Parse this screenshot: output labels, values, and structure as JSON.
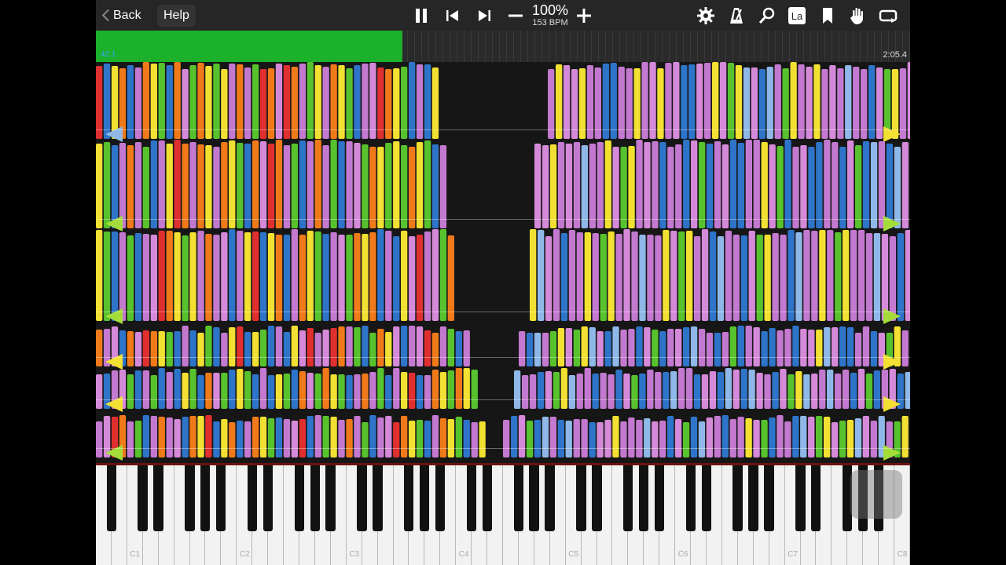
{
  "toolbar": {
    "back_label": "Back",
    "help_label": "Help",
    "tempo_percent": "100%",
    "tempo_bpm": "153 BPM",
    "icons": [
      "pause-icon",
      "skip-back-icon",
      "skip-forward-icon",
      "minus-icon",
      "plus-icon",
      "gear-icon",
      "metronome-icon",
      "search-icon",
      "label-icon",
      "bookmark-icon",
      "hand-icon",
      "loop-icon"
    ],
    "label_icon_text": "La"
  },
  "progress": {
    "fraction": 0.376,
    "current_time": "42.1",
    "total_time": "2:05.4",
    "fill_color": "#1bb12a"
  },
  "note_roll": {
    "colors": {
      "red": "#e02f2f",
      "orange": "#f07a1a",
      "yellow": "#f2e032",
      "green": "#57c22d",
      "blue": "#2e74c9",
      "lightblue": "#8fb8e8",
      "purple": "#c379cf",
      "pink": "#d58ad9"
    },
    "hand_markers": [
      "#8fb8e8",
      "#a4dd3a",
      "#a4dd3a",
      "#f2e032",
      "#f2e032",
      "#a4dd3a"
    ]
  },
  "keyboard": {
    "octave_labels": [
      "C1",
      "C2",
      "C3",
      "C4",
      "C5",
      "C6",
      "C7",
      "C8"
    ]
  }
}
